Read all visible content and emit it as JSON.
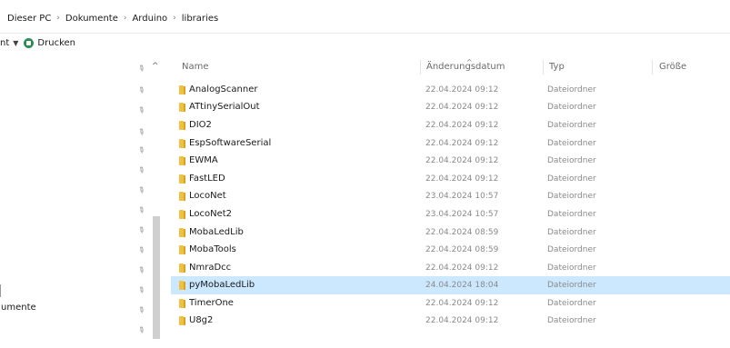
{
  "breadcrumb": {
    "segments": [
      "Dieser PC",
      "Dokumente",
      "Arduino",
      "libraries"
    ]
  },
  "toolbar": {
    "left_label": "nt",
    "print_label": "Drucken"
  },
  "navpane": {
    "partial_label": "umente"
  },
  "columns": {
    "name": "Name",
    "date": "Änderungsdatum",
    "type": "Typ",
    "size": "Größe"
  },
  "files": [
    {
      "name": "AnalogScanner",
      "date": "22.04.2024 09:12",
      "type": "Dateiordner",
      "selected": false
    },
    {
      "name": "ATtinySerialOut",
      "date": "22.04.2024 09:12",
      "type": "Dateiordner",
      "selected": false
    },
    {
      "name": "DIO2",
      "date": "22.04.2024 09:12",
      "type": "Dateiordner",
      "selected": false
    },
    {
      "name": "EspSoftwareSerial",
      "date": "22.04.2024 09:12",
      "type": "Dateiordner",
      "selected": false
    },
    {
      "name": "EWMA",
      "date": "22.04.2024 09:12",
      "type": "Dateiordner",
      "selected": false
    },
    {
      "name": "FastLED",
      "date": "22.04.2024 09:12",
      "type": "Dateiordner",
      "selected": false
    },
    {
      "name": "LocoNet",
      "date": "23.04.2024 10:57",
      "type": "Dateiordner",
      "selected": false
    },
    {
      "name": "LocoNet2",
      "date": "23.04.2024 10:57",
      "type": "Dateiordner",
      "selected": false
    },
    {
      "name": "MobaLedLib",
      "date": "22.04.2024 08:59",
      "type": "Dateiordner",
      "selected": false
    },
    {
      "name": "MobaTools",
      "date": "22.04.2024 08:59",
      "type": "Dateiordner",
      "selected": false
    },
    {
      "name": "NmraDcc",
      "date": "22.04.2024 09:12",
      "type": "Dateiordner",
      "selected": false
    },
    {
      "name": "pyMobaLedLib",
      "date": "24.04.2024 18:04",
      "type": "Dateiordner",
      "selected": true
    },
    {
      "name": "TimerOne",
      "date": "22.04.2024 09:12",
      "type": "Dateiordner",
      "selected": false
    },
    {
      "name": "U8g2",
      "date": "22.04.2024 09:12",
      "type": "Dateiordner",
      "selected": false
    }
  ],
  "icons": {
    "folder": "folder-icon",
    "pin": "pin-icon",
    "print": "print-icon",
    "separator": "chevron-right-icon"
  },
  "colors": {
    "selection": "#cce8ff",
    "folder": "#f0c040"
  }
}
